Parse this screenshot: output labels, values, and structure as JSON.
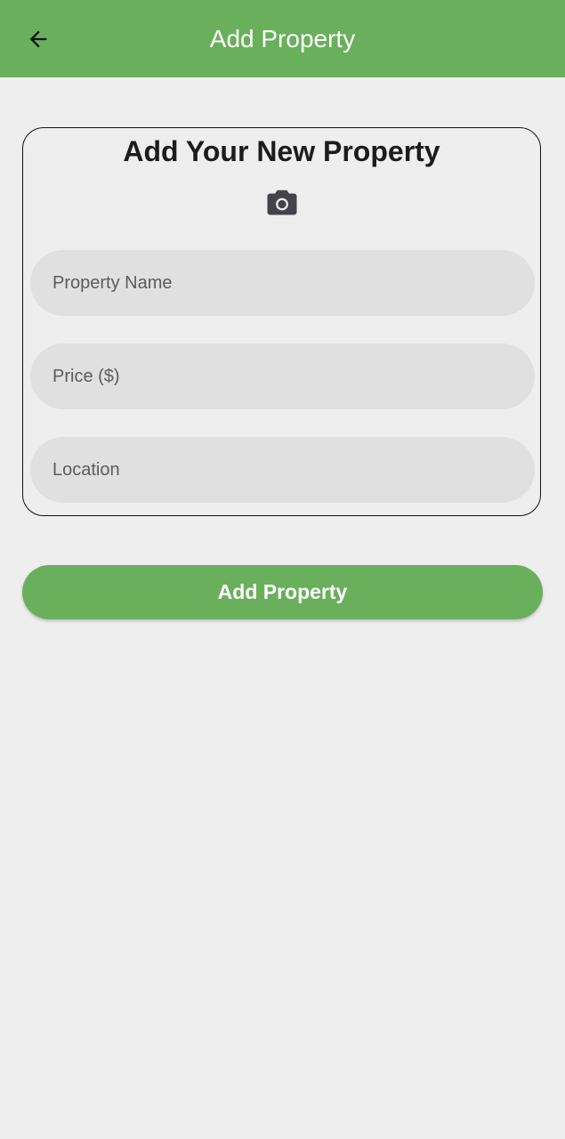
{
  "colors": {
    "accent": "#6aaf5c",
    "background": "#eeeeee",
    "field_background": "#e0e0e0",
    "on_accent": "#ffffff"
  },
  "app_bar": {
    "back_icon": "arrow-left-icon",
    "title": "Add Property"
  },
  "form": {
    "title": "Add Your New Property",
    "camera_icon": "camera-icon",
    "fields": [
      {
        "label": "Property Name",
        "value": ""
      },
      {
        "label": "Price ($)",
        "value": ""
      },
      {
        "label": "Location",
        "value": ""
      }
    ]
  },
  "submit": {
    "label": "Add Property"
  }
}
